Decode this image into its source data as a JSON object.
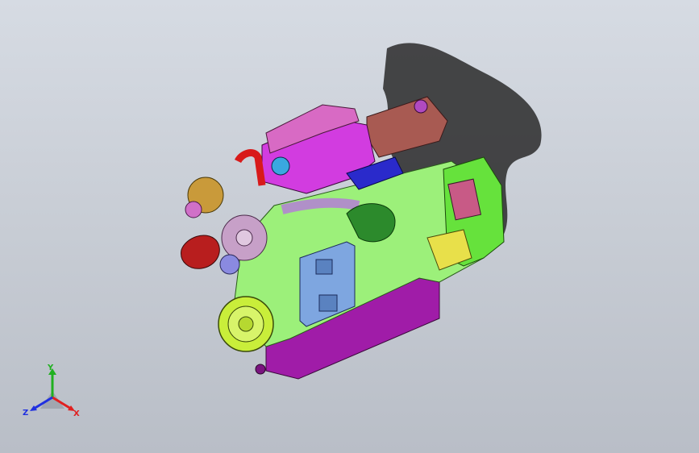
{
  "viewport": {
    "background_top": "#d6dbe3",
    "background_bottom": "#b9bec7"
  },
  "model": {
    "description_icon": "engine-3d-model",
    "colors": {
      "shadow": "#2a2a2a",
      "block": "#9cf07a",
      "oil_pan": "#a01ca8",
      "valve_cover": "#d23ce0",
      "rocker_cover": "#a85a52",
      "damper": "#c9ee3a",
      "pulley": "#c7a0c8",
      "turbo": "#c99a3a",
      "alternator": "#b81e1e",
      "ecu": "#7ea6e0",
      "intake": "#2a2acb",
      "elbow": "#2c8a2c",
      "flywheel_housing": "#66e23c",
      "wiring_panel": "#e8e04a"
    }
  },
  "triad": {
    "x_label": "X",
    "y_label": "Y",
    "z_label": "Z",
    "x_color": "#e02020",
    "y_color": "#20b020",
    "z_color": "#2030e0"
  }
}
